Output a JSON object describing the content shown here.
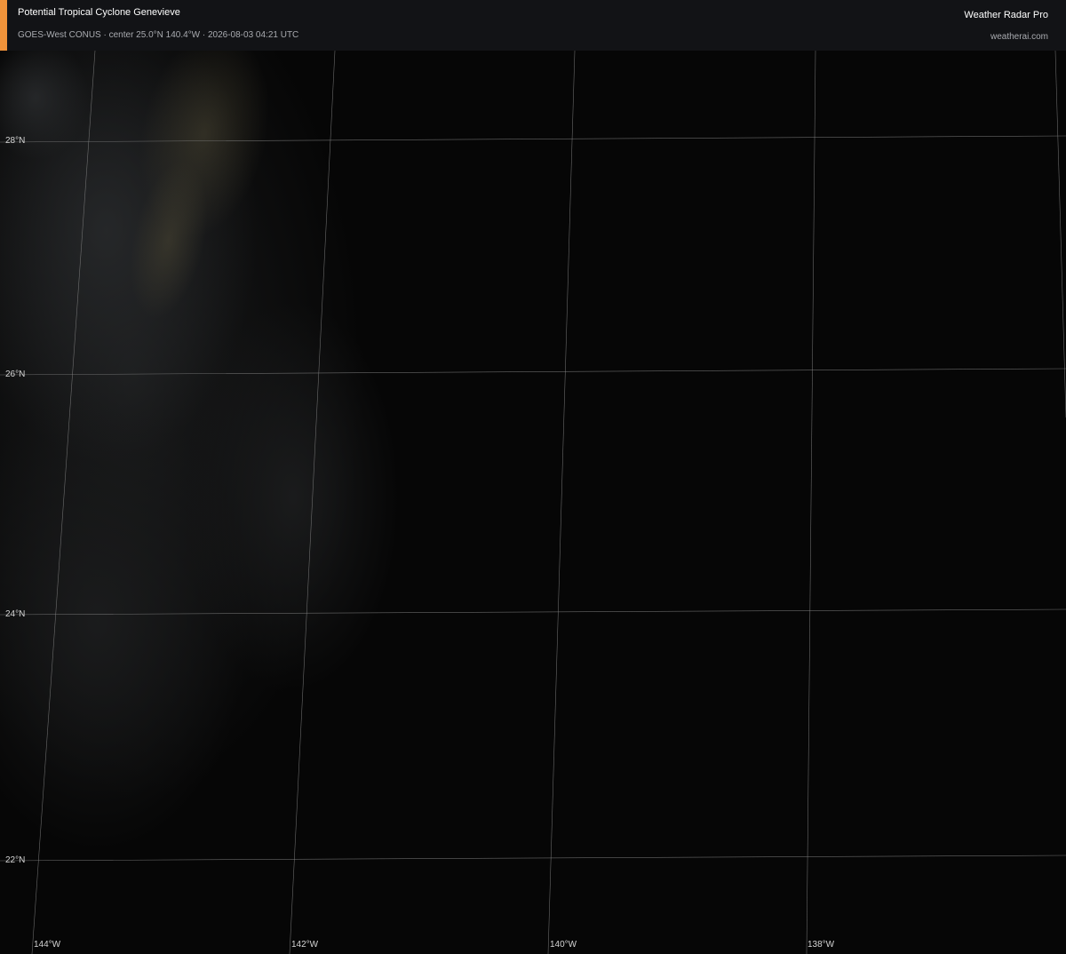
{
  "header": {
    "title": "Potential Tropical Cyclone Genevieve",
    "subtitle": "GOES-West CONUS · center 25.0°N 140.4°W · 2026-08-03 04:21 UTC",
    "brand": "Weather Radar Pro",
    "site": "weatherai.com",
    "accent_color": "#f0933a"
  },
  "map": {
    "type": "satellite-imagery",
    "background_color": "#060606",
    "gridline_color": "#8a8a8a",
    "latitude_labels": [
      "28°N",
      "26°N",
      "24°N",
      "22°N"
    ],
    "longitude_labels": [
      "144°W",
      "142°W",
      "140°W",
      "138°W"
    ]
  }
}
